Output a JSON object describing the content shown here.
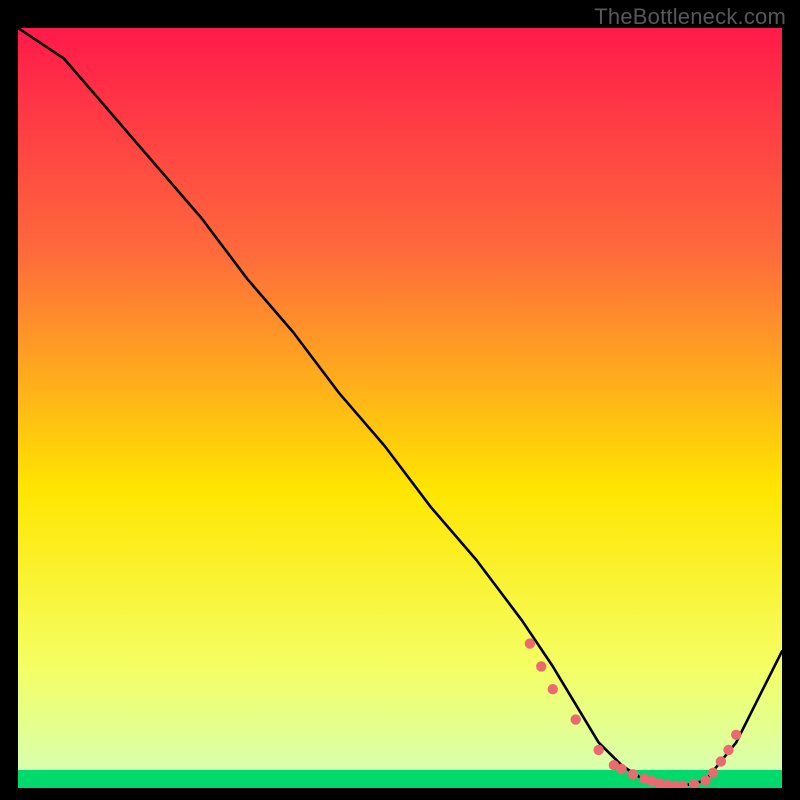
{
  "watermark": "TheBottleneck.com",
  "colors": {
    "top_gradient": "#ff1a4a",
    "mid_gradient": "#ffe600",
    "bottom_band": "#00d96b",
    "line": "#000000",
    "dot": "#e96a6f"
  },
  "chart_data": {
    "type": "line",
    "title": "",
    "xlabel": "",
    "ylabel": "",
    "xlim": [
      0,
      100
    ],
    "ylim": [
      0,
      100
    ],
    "grid": false,
    "legend": false,
    "series": [
      {
        "name": "bottleneck-curve",
        "x": [
          0,
          6,
          12,
          18,
          24,
          30,
          36,
          42,
          48,
          54,
          60,
          66,
          70,
          73,
          76,
          79,
          82,
          86,
          90,
          94,
          100
        ],
        "y": [
          100,
          96,
          89,
          82,
          75,
          67,
          60,
          52,
          45,
          37,
          30,
          22,
          16,
          11,
          6,
          3,
          1,
          0,
          1,
          6,
          18
        ]
      }
    ],
    "markers": {
      "name": "highlight-dots",
      "x": [
        67,
        68.5,
        70,
        73,
        76,
        78,
        79,
        80.5,
        82,
        83,
        84,
        85,
        86,
        87,
        88.5,
        90,
        91,
        92,
        93,
        94
      ],
      "y": [
        19,
        16,
        13,
        9,
        5,
        3,
        2.5,
        1.8,
        1.2,
        0.9,
        0.6,
        0.4,
        0.3,
        0.3,
        0.5,
        1.0,
        2.0,
        3.5,
        5,
        7
      ]
    }
  }
}
